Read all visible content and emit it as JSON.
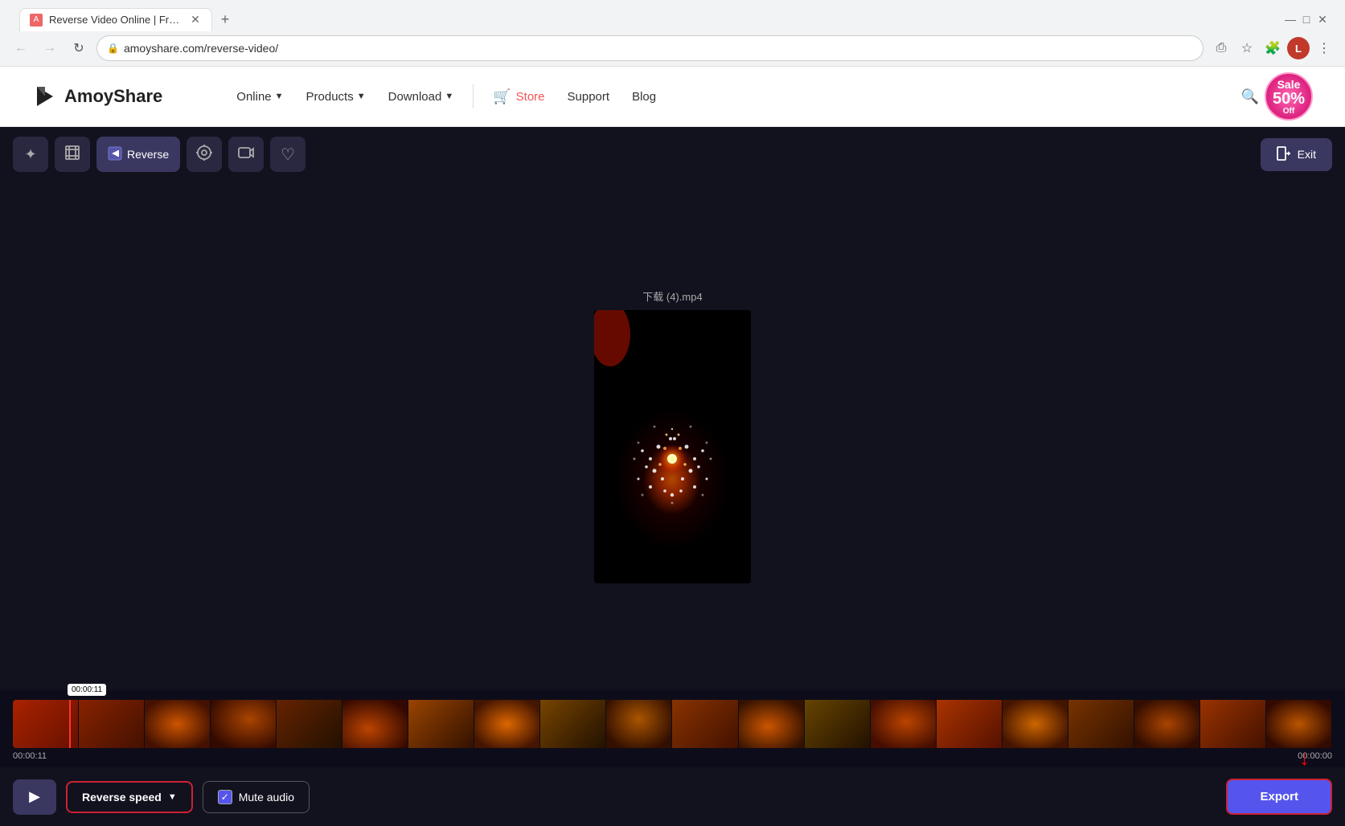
{
  "browser": {
    "tab": {
      "title": "Reverse Video Online | Free Vide",
      "url": "amoyshare.com/reverse-video/"
    },
    "nav_back_disabled": true,
    "nav_forward_disabled": true
  },
  "website": {
    "logo": "AmoyShare",
    "nav": {
      "online": "Online",
      "products": "Products",
      "download": "Download",
      "store": "Store",
      "support": "Support",
      "blog": "Blog"
    },
    "sale": {
      "text": "Sale",
      "percent": "50%",
      "off": "Off"
    }
  },
  "editor": {
    "tools": {
      "magic": "✦",
      "crop": "⊡",
      "reverse": "Reverse",
      "screenshot": "⊙",
      "record": "⊚",
      "heart": "♡"
    },
    "exit_label": "Exit",
    "video_filename": "下载 (4).mp4",
    "timeline": {
      "start_time": "00:00:11",
      "end_time": "00:00:00",
      "cursor_time": "00:00:11"
    },
    "controls": {
      "play_label": "▶",
      "reverse_speed_label": "Reverse speed",
      "mute_label": "Mute audio",
      "export_label": "Export"
    }
  }
}
